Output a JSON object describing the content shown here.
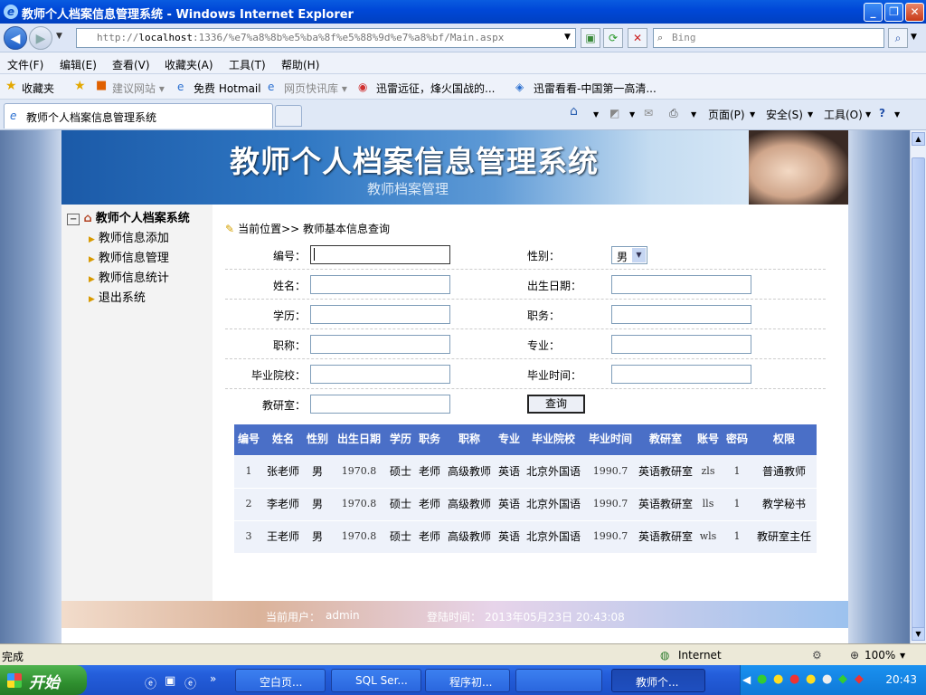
{
  "window": {
    "title": "教师个人档案信息管理系统 - Windows Internet Explorer"
  },
  "browser": {
    "url_prefix": "http://",
    "url_host": "localhost",
    "url_rest": ":1336/%e7%a8%8b%e5%ba%8f%e5%88%9d%e7%a8%bf/Main.aspx",
    "search_placeholder": "Bing",
    "menu": [
      "文件(F)",
      "编辑(E)",
      "查看(V)",
      "收藏夹(A)",
      "工具(T)",
      "帮助(H)"
    ],
    "favorites": [
      "收藏夹",
      "建议网站 ▾",
      "免费 Hotmail",
      "网页快讯库 ▾",
      "迅雷远征，烽火国战的...",
      "迅雷看看-中国第一高清..."
    ],
    "tab_title": "教师个人档案信息管理系统",
    "tools": {
      "page": "页面(P)",
      "safety": "安全(S)",
      "tools": "工具(O)"
    }
  },
  "banner": {
    "title": "教师个人档案信息管理系统",
    "subtitle": "教师档案管理"
  },
  "nav": {
    "root": "教师个人档案系统",
    "items": [
      "教师信息添加",
      "教师信息管理",
      "教师信息统计",
      "退出系统"
    ]
  },
  "breadcrumb": "当前位置>> 教师基本信息查询",
  "form": {
    "id_label": "编号：",
    "sex_label": "性别：",
    "sex_value": "男",
    "name_label": "姓名：",
    "birth_label": "出生日期：",
    "edu_label": "学历：",
    "duty_label": "职务：",
    "title_label": "职称：",
    "major_label": "专业：",
    "school_label": "毕业院校：",
    "gradtime_label": "毕业时间：",
    "office_label": "教研室：",
    "query_button": "查询"
  },
  "table": {
    "headers": [
      "编号",
      "姓名",
      "性别",
      "出生日期",
      "学历",
      "职务",
      "职称",
      "专业",
      "毕业院校",
      "毕业时间",
      "教研室",
      "账号",
      "密码",
      "权限"
    ],
    "rows": [
      [
        "1",
        "张老师",
        "男",
        "1970.8",
        "硕士",
        "老师",
        "高级教师",
        "英语",
        "北京外国语",
        "1990.7",
        "英语教研室",
        "zls",
        "1",
        "普通教师"
      ],
      [
        "2",
        "李老师",
        "男",
        "1970.8",
        "硕士",
        "老师",
        "高级教师",
        "英语",
        "北京外国语",
        "1990.7",
        "英语教研室",
        "lls",
        "1",
        "教学秘书"
      ],
      [
        "3",
        "王老师",
        "男",
        "1970.8",
        "硕士",
        "老师",
        "高级教师",
        "英语",
        "北京外国语",
        "1990.7",
        "英语教研室",
        "wls",
        "1",
        "教研室主任"
      ]
    ]
  },
  "footer": {
    "user_label": "当前用户：",
    "user_value": "admin",
    "login_label": "登陆时间：",
    "login_value": "2013年05月23日  20:43:08"
  },
  "status": {
    "left": "完成",
    "zone": "Internet",
    "zoom": "100%"
  },
  "taskbar": {
    "start": "开始",
    "tasks": [
      "空白页...",
      "SQL Ser...",
      "程序初...",
      "",
      "教师个..."
    ],
    "clock": "20:43"
  },
  "colors": {
    "header_blue": "#4a6fc7",
    "titlebar": "#0048d8",
    "taskbar": "#245edb"
  }
}
